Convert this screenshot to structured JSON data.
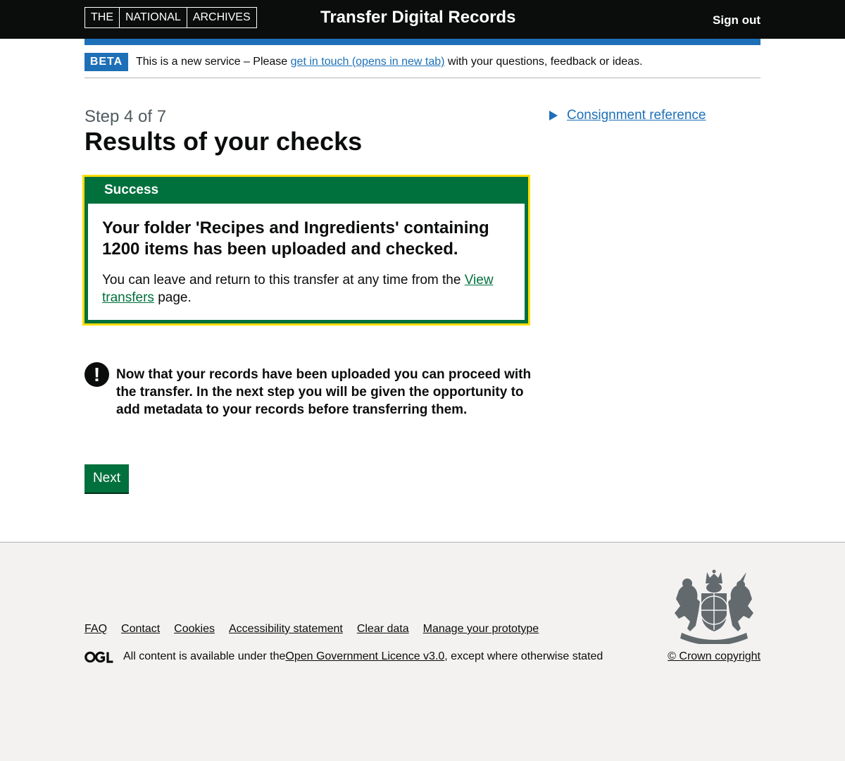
{
  "header": {
    "logo_words": [
      "THE",
      "NATIONAL",
      "ARCHIVES"
    ],
    "service_name": "Transfer Digital Records",
    "sign_out": "Sign out"
  },
  "phase_banner": {
    "tag": "BETA",
    "text_before": "This is a new service – Please ",
    "link": "get in touch (opens in new tab)",
    "text_after": " with your questions, feedback or ideas."
  },
  "page": {
    "caption": "Step 4 of 7",
    "title": "Results of your checks"
  },
  "sidebar": {
    "details_summary": "Consignment reference"
  },
  "success_panel": {
    "title": "Success",
    "heading": "Your folder 'Recipes and Ingredients' containing 1200 items has been uploaded and checked.",
    "text_before": "You can leave and return to this transfer at any time from the ",
    "link": "View transfers",
    "text_after": " page."
  },
  "warning": {
    "icon": "!",
    "text": "Now that your records have been uploaded you can proceed with the transfer. In the next step you will be given the opportunity to add metadata to your records before transferring them."
  },
  "actions": {
    "next_label": "Next"
  },
  "footer": {
    "links": [
      "FAQ",
      "Contact",
      "Cookies",
      "Accessibility statement",
      "Clear data",
      "Manage your prototype"
    ],
    "licence_before": "All content is available under the ",
    "licence_link": "Open Government Licence v3.0",
    "licence_after": ", except where otherwise stated",
    "copyright": "© Crown copyright"
  },
  "colors": {
    "header_bg": "#0b0c0c",
    "brand_blue": "#1d70b8",
    "success_green": "#00703c",
    "focus_yellow": "#ffdd00",
    "footer_bg": "#f3f2f1"
  }
}
